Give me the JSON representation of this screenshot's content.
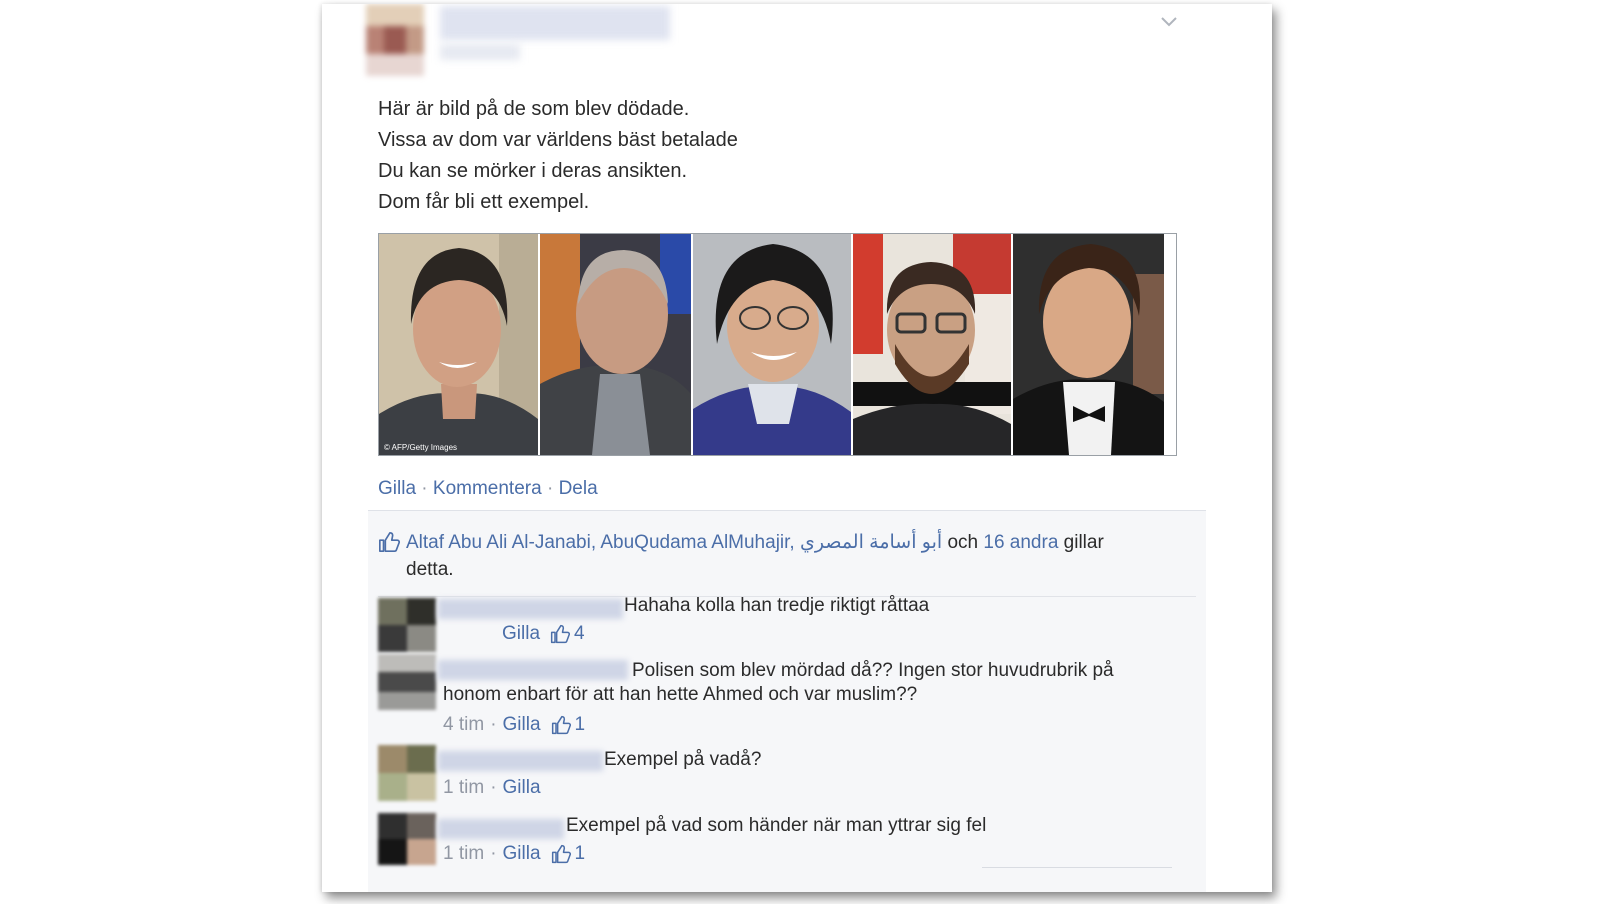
{
  "post": {
    "lines": [
      "Här är bild på de som blev dödade.",
      "Vissa av dom var världens bäst betalade",
      "Du kan se mörker i deras ansikten.",
      "Dom får bli ett exempel."
    ],
    "photo_credit": "© AFP/Getty Images"
  },
  "actions": {
    "like": "Gilla",
    "comment": "Kommentera",
    "share": "Dela",
    "separator": "·"
  },
  "likes": {
    "names": [
      "Altaf Abu Ali Al-Janabi",
      "AbuQudama AlMuhajir",
      "أبو أسامة المصري"
    ],
    "comma": ",",
    "and_word": "och",
    "others": "16 andra",
    "suffix_a": "gillar",
    "suffix_b": "detta."
  },
  "comments": [
    {
      "text": "Hahaha kolla han tredje riktigt råttaa",
      "time": "",
      "like": "Gilla",
      "count": "4"
    },
    {
      "text": "Polisen som blev mördad då?? Ingen stor huvudrubrik på",
      "text2": "honom enbart för att han hette Ahmed och var muslim??",
      "time": "4 tim",
      "like": "Gilla",
      "count": "1"
    },
    {
      "text": "Exempel på vadå?",
      "time": "1 tim",
      "like": "Gilla",
      "count": ""
    },
    {
      "text": "Exempel på vad som händer när man yttrar sig fel",
      "time": "1 tim",
      "like": "Gilla",
      "count": "1"
    }
  ],
  "meta_separator": "·",
  "colors": {
    "link": "#4b6ea8",
    "muted": "#9197a3",
    "text": "#2b2b2b",
    "panel": "#f6f7f9"
  },
  "icons": [
    "chevron-down-icon",
    "thumbs-up-icon"
  ]
}
